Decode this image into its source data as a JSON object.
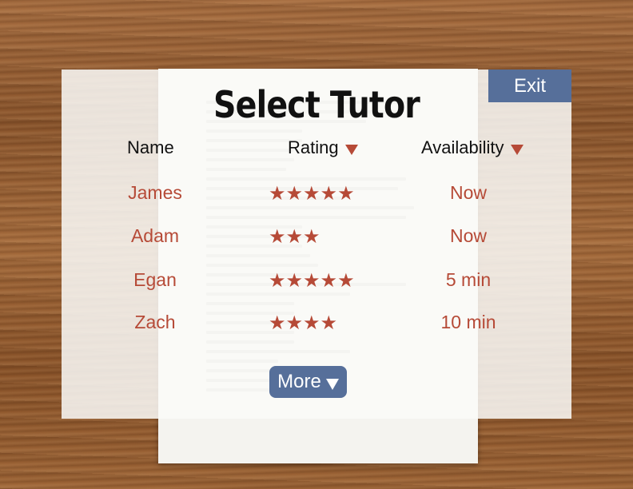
{
  "title": "Select Tutor",
  "exit_label": "Exit",
  "more_label": "More",
  "headers": {
    "name": "Name",
    "rating": "Rating",
    "availability": "Availability"
  },
  "tutors": [
    {
      "name": "James",
      "rating": 5,
      "stars": "★★★★★",
      "availability": "Now"
    },
    {
      "name": "Adam",
      "rating": 3,
      "stars": "★★★",
      "availability": "Now"
    },
    {
      "name": "Egan",
      "rating": 5,
      "stars": "★★★★★",
      "availability": "5 min"
    },
    {
      "name": "Zach",
      "rating": 4,
      "stars": "★★★★",
      "availability": "10 min"
    }
  ],
  "colors": {
    "accent": "#b64a37",
    "button": "#566f9a"
  },
  "icons": {
    "sort": "triangle-down-icon",
    "star": "star-icon",
    "more": "triangle-down-icon"
  }
}
